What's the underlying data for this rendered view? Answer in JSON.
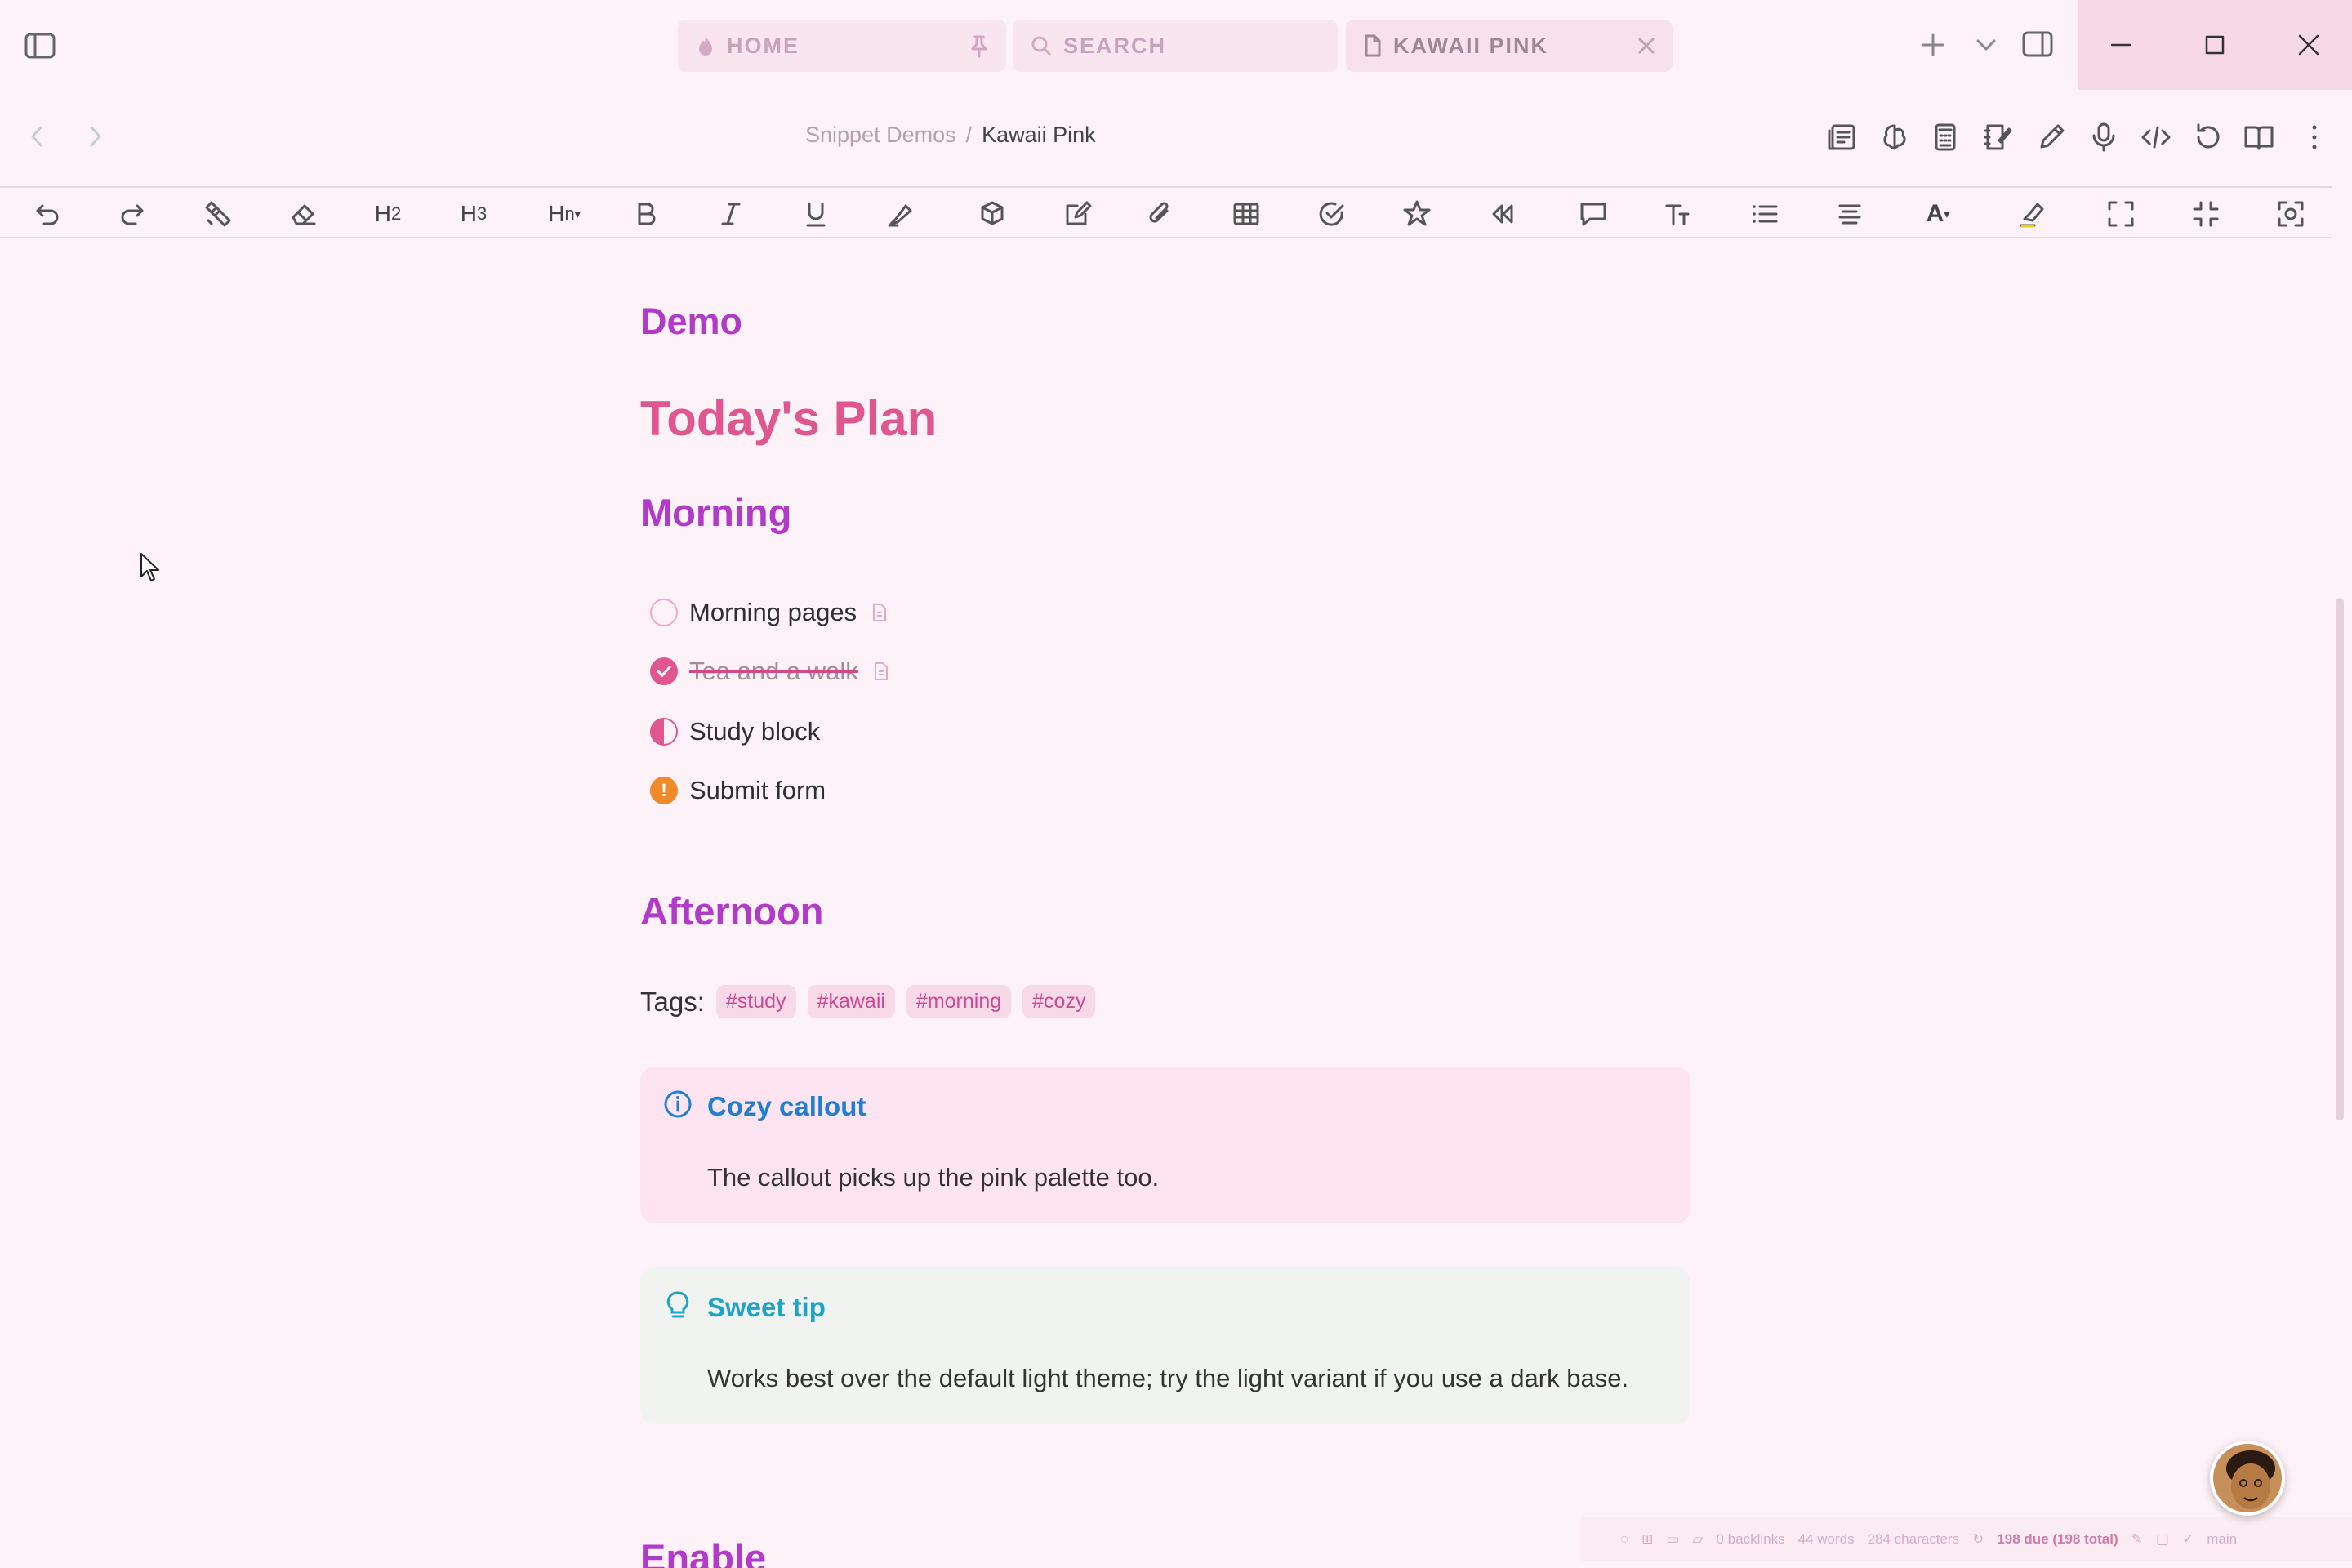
{
  "tabs": [
    {
      "label": "HOME",
      "icon": "flame-icon",
      "pinned": true
    },
    {
      "label": "SEARCH",
      "icon": "search-icon"
    },
    {
      "label": "KAWAII PINK",
      "icon": "file-icon",
      "active": true
    }
  ],
  "breadcrumb": {
    "parent": "Snippet Demos",
    "separator": "/",
    "current": "Kawaii Pink"
  },
  "content": {
    "demo_heading": "Demo",
    "plan_heading": "Today's Plan",
    "morning_heading": "Morning",
    "tasks": [
      {
        "label": "Morning pages",
        "status": "open"
      },
      {
        "label": "Tea and a walk",
        "status": "done"
      },
      {
        "label": "Study block",
        "status": "in-progress"
      },
      {
        "label": "Submit form",
        "status": "important"
      }
    ],
    "afternoon_heading": "Afternoon",
    "tags_label": "Tags:",
    "tags": [
      "#study",
      "#kawaii",
      "#morning",
      "#cozy"
    ],
    "callouts": [
      {
        "title": "Cozy callout",
        "body": "The callout picks up the pink palette too.",
        "icon": "info-icon"
      },
      {
        "title": "Sweet tip",
        "body": "Works best over the default light theme; try the light variant if you use a dark base.",
        "icon": "lightbulb-icon"
      }
    ],
    "enable_heading": "Enable"
  },
  "statusbar": {
    "backlinks": "0 backlinks",
    "words": "44 words",
    "characters": "284 characters",
    "due": "198 due (198 total)",
    "branch": "main"
  },
  "colors": {
    "background": "#fdf2f7",
    "heading_purple": "#b13ac8",
    "heading_pink": "#e0568f",
    "tag_bg": "#f8d9e8",
    "callout_info": "#1e7fd3",
    "callout_tip": "#1fa3c9",
    "important_orange": "#f0892a"
  }
}
